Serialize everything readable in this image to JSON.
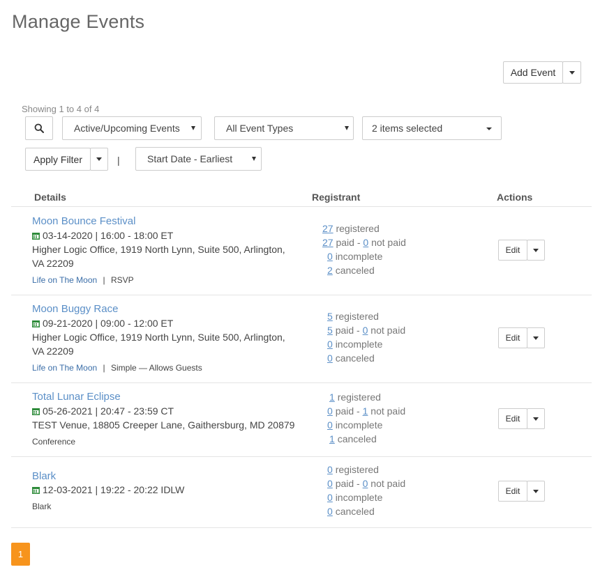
{
  "header": {
    "title": "Manage Events"
  },
  "toolbar": {
    "add_event_label": "Add Event"
  },
  "filters": {
    "showing": "Showing 1 to 4 of 4",
    "status_select": "Active/Upcoming Events",
    "type_select": "All Event Types",
    "items_select": "2 items selected",
    "apply_label": "Apply Filter",
    "separator": "|",
    "sort_select": "Start Date - Earliest"
  },
  "table": {
    "columns": [
      "Details",
      "Registrant",
      "Actions"
    ],
    "edit_label": "Edit",
    "labels": {
      "registered": "registered",
      "paid": "paid",
      "not_paid": "not paid",
      "incomplete": "incomplete",
      "canceled": "canceled",
      "dash": "-",
      "pipe": "|"
    },
    "rows": [
      {
        "title": "Moon Bounce Festival",
        "date": "03-14-2020 | 16:00 - 18:00 ET",
        "location": "Higher Logic Office, 1919 North Lynn, Suite 500, Arlington, VA 22209",
        "category": "Life on The Moon",
        "type": "RSVP",
        "registered": "27",
        "paid": "27",
        "not_paid": "0",
        "incomplete": "0",
        "canceled": "2"
      },
      {
        "title": "Moon Buggy Race",
        "date": "09-21-2020 | 09:00 - 12:00 ET",
        "location": "Higher Logic Office, 1919 North Lynn, Suite 500, Arlington, VA 22209",
        "category": "Life on The Moon",
        "type": "Simple — Allows Guests",
        "registered": "5",
        "paid": "5",
        "not_paid": "0",
        "incomplete": "0",
        "canceled": "0"
      },
      {
        "title": "Total Lunar Eclipse",
        "date": "05-26-2021 | 20:47 - 23:59 CT",
        "location": "TEST Venue, 18805 Creeper Lane, Gaithersburg, MD 20879",
        "category": "Conference",
        "registered": "1",
        "paid": "0",
        "not_paid": "1",
        "incomplete": "0",
        "canceled": "1"
      },
      {
        "title": "Blark",
        "date": "12-03-2021 | 19:22 - 20:22 IDLW",
        "category": "Blark",
        "registered": "0",
        "paid": "0",
        "not_paid": "0",
        "incomplete": "0",
        "canceled": "0"
      }
    ]
  },
  "pagination": {
    "current": "1"
  },
  "colors": {
    "link": "#5b8fc7",
    "accent": "#f7941d",
    "calendar": "#2e8b3a"
  }
}
